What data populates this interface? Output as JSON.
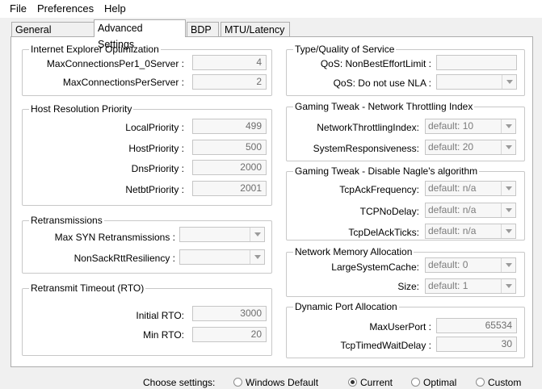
{
  "menu": {
    "file": "File",
    "preferences": "Preferences",
    "help": "Help"
  },
  "tabs": [
    "General Settings",
    "Advanced Settings",
    "BDP",
    "MTU/Latency"
  ],
  "ie": {
    "legend": "Internet Explorer Optimization",
    "rows": [
      {
        "label": "MaxConnectionsPer1_0Server :",
        "value": "4"
      },
      {
        "label": "MaxConnectionsPerServer :",
        "value": "2"
      }
    ]
  },
  "host": {
    "legend": "Host Resolution Priority",
    "rows": [
      {
        "label": "LocalPriority :",
        "value": "499"
      },
      {
        "label": "HostPriority :",
        "value": "500"
      },
      {
        "label": "DnsPriority :",
        "value": "2000"
      },
      {
        "label": "NetbtPriority :",
        "value": "2001"
      }
    ]
  },
  "retrans": {
    "legend": "Retransmissions",
    "rows": [
      {
        "label": "Max SYN Retransmissions :",
        "value": ""
      },
      {
        "label": "NonSackRttResiliency :",
        "value": ""
      }
    ]
  },
  "rto": {
    "legend": "Retransmit Timeout (RTO)",
    "rows": [
      {
        "label": "Initial RTO:",
        "value": "3000"
      },
      {
        "label": "Min RTO:",
        "value": "20"
      }
    ]
  },
  "qos": {
    "legend": "Type/Quality of Service",
    "rows": [
      {
        "label": "QoS: NonBestEffortLimit :",
        "value": ""
      },
      {
        "label": "QoS: Do not use NLA :",
        "value": ""
      }
    ]
  },
  "throttle": {
    "legend": "Gaming Tweak - Network Throttling Index",
    "rows": [
      {
        "label": "NetworkThrottlingIndex:",
        "value": "default: 10"
      },
      {
        "label": "SystemResponsiveness:",
        "value": "default: 20"
      }
    ]
  },
  "nagle": {
    "legend": "Gaming Tweak - Disable Nagle's algorithm",
    "rows": [
      {
        "label": "TcpAckFrequency:",
        "value": "default: n/a"
      },
      {
        "label": "TCPNoDelay:",
        "value": "default: n/a"
      },
      {
        "label": "TcpDelAckTicks:",
        "value": "default: n/a"
      }
    ]
  },
  "memory": {
    "legend": "Network Memory Allocation",
    "rows": [
      {
        "label": "LargeSystemCache:",
        "value": "default: 0"
      },
      {
        "label": "Size:",
        "value": "default: 1"
      }
    ]
  },
  "ports": {
    "legend": "Dynamic Port Allocation",
    "rows": [
      {
        "label": "MaxUserPort :",
        "value": "65534"
      },
      {
        "label": "TcpTimedWaitDelay :",
        "value": "30"
      }
    ]
  },
  "bottom": {
    "choose": "Choose settings:",
    "options": [
      {
        "label": "Windows Default",
        "checked": false
      },
      {
        "label": "Current",
        "checked": true
      },
      {
        "label": "Optimal",
        "checked": false
      },
      {
        "label": "Custom",
        "checked": false
      }
    ]
  }
}
